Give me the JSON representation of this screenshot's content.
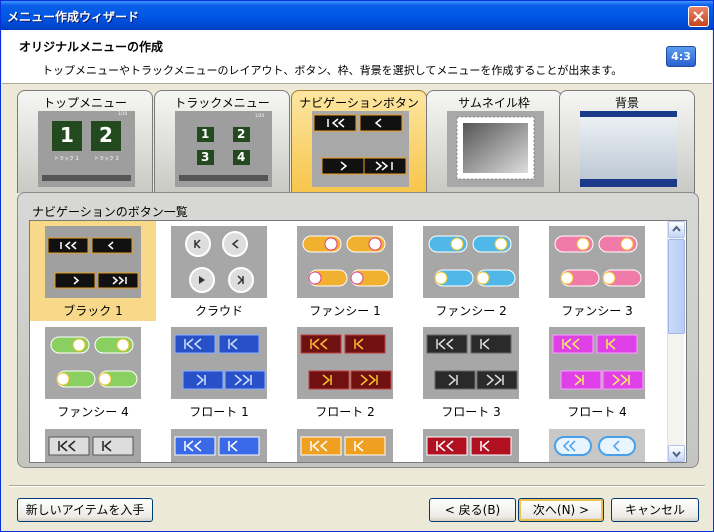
{
  "window": {
    "title": "メニュー作成ウィザード"
  },
  "header": {
    "title": "オリジナルメニューの作成",
    "description": "トップメニューやトラックメニューのレイアウト、ボタン、枠、背景を選択してメニューを作成することが出来ます。",
    "aspect_ratio": "4:3"
  },
  "tabs": [
    {
      "label": "トップメニュー",
      "active": false
    },
    {
      "label": "トラックメニュー",
      "active": false
    },
    {
      "label": "ナビゲーションボタン",
      "active": true
    },
    {
      "label": "サムネイル枠",
      "active": false
    },
    {
      "label": "背景",
      "active": false
    }
  ],
  "top_menu_thumb": {
    "big1": "1",
    "big2": "2",
    "cap1": "トラック 1",
    "cap2": "トラック 2",
    "page": "1/10"
  },
  "track_menu_thumb": {
    "n1": "1",
    "n2": "2",
    "n3": "3",
    "n4": "4",
    "page": "1/20"
  },
  "list": {
    "label": "ナビゲーションのボタン一覧",
    "items": [
      {
        "label": "ブラック 1",
        "selected": true
      },
      {
        "label": "クラウド"
      },
      {
        "label": "ファンシー 1"
      },
      {
        "label": "ファンシー 2"
      },
      {
        "label": "ファンシー 3"
      },
      {
        "label": "ファンシー 4"
      },
      {
        "label": "フロート 1"
      },
      {
        "label": "フロート 2"
      },
      {
        "label": "フロート 3"
      },
      {
        "label": "フロート 4"
      }
    ]
  },
  "buttons": {
    "get_new_items": "新しいアイテムを入手",
    "back": "< 戻る(B)",
    "next": "次へ(N) >",
    "cancel": "キャンセル"
  }
}
